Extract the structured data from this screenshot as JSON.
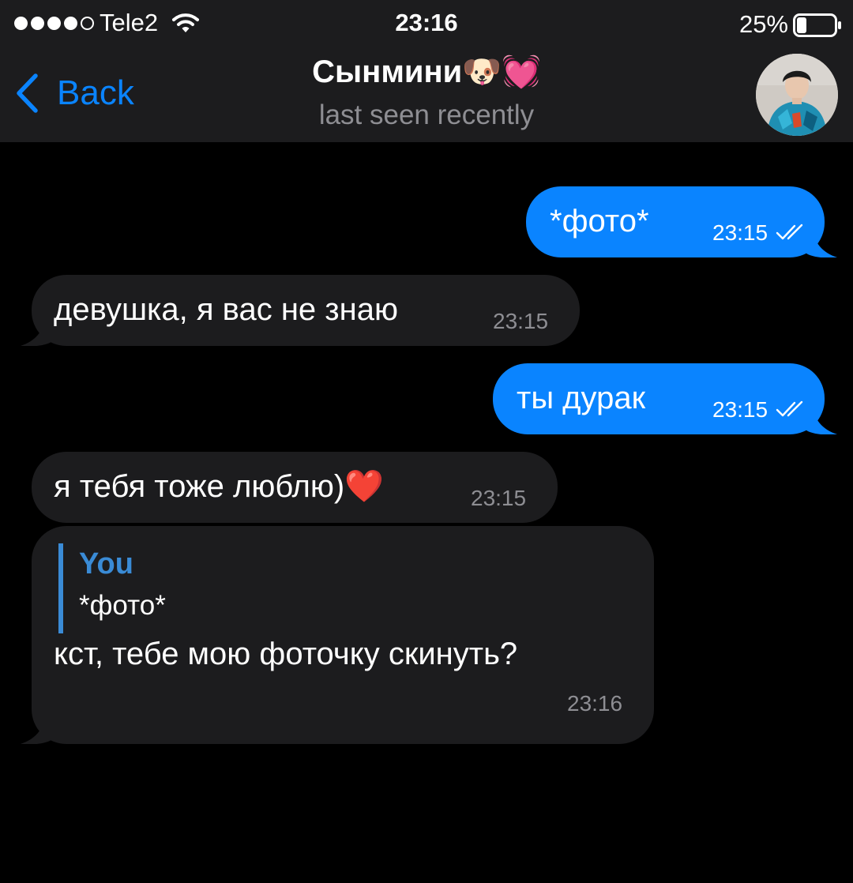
{
  "status_bar": {
    "carrier": "Tele2",
    "time": "23:16",
    "battery_percent": "25%",
    "signal_bars_filled": 4,
    "signal_bars_total": 5,
    "battery_level": 0.25
  },
  "header": {
    "back_label": "Back",
    "title": "Сынмини🐶💓",
    "status": "last seen recently",
    "avatar_icon": "contact-avatar-photo"
  },
  "messages": [
    {
      "direction": "outgoing",
      "text": "*фото*",
      "time": "23:15",
      "read": true
    },
    {
      "direction": "incoming",
      "text": "девушка, я вас не знаю",
      "time": "23:15"
    },
    {
      "direction": "outgoing",
      "text": "ты дурак",
      "time": "23:15",
      "read": true
    },
    {
      "direction": "incoming",
      "text": "я тебя тоже люблю)❤️",
      "time": "23:15"
    },
    {
      "direction": "incoming",
      "reply_to": {
        "author": "You",
        "text": "*фото*"
      },
      "text": "кст, тебе мою фоточку скинуть?",
      "time": "23:16"
    }
  ],
  "colors": {
    "outgoing_bubble": "#0a84ff",
    "incoming_bubble": "#1c1c1e",
    "bar_background": "#1c1c1e",
    "accent": "#0a84ff",
    "reply_accent": "#3a8bd6",
    "secondary_text": "#8e8e93"
  }
}
